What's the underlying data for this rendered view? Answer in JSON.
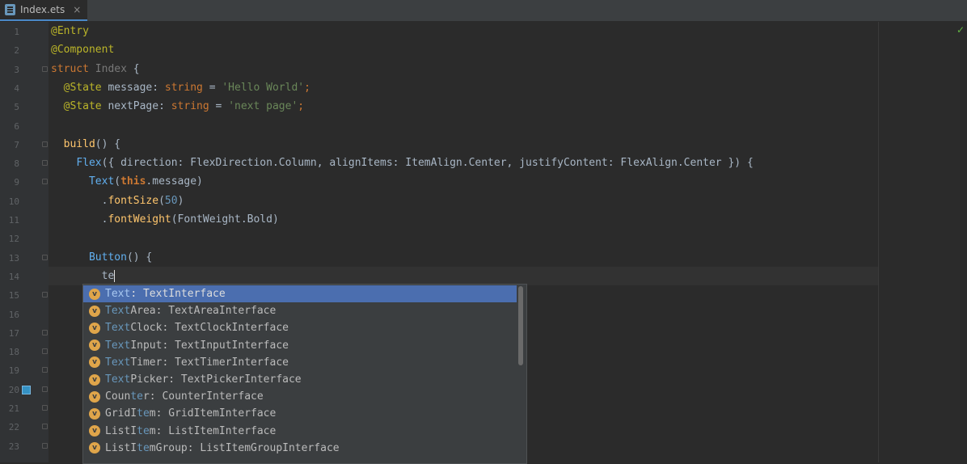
{
  "tab": {
    "label": "Index.ets",
    "close": "×"
  },
  "gutter": {
    "line_numbers": [
      "1",
      "2",
      "3",
      "4",
      "5",
      "6",
      "7",
      "8",
      "9",
      "10",
      "11",
      "12",
      "13",
      "14",
      "15",
      "16",
      "17",
      "18",
      "19",
      "20",
      "21",
      "22",
      "23"
    ]
  },
  "code": {
    "l1": "@Entry",
    "l2": "@Component",
    "l3_kw": "struct",
    "l3_name": "Index",
    "l3_brace": " {",
    "l4_ann": "@State",
    "l4_name": " message",
    "l4_colon": ": ",
    "l4_type": "string",
    "l4_eq": " = ",
    "l4_val": "'Hello World'",
    "l4_end": ";",
    "l5_ann": "@State",
    "l5_name": " nextPage",
    "l5_colon": ": ",
    "l5_type": "string",
    "l5_eq": " = ",
    "l5_val": "'next page'",
    "l5_end": ";",
    "l7_fn": "build",
    "l7_rest": "() {",
    "l8_comp": "Flex",
    "l8_rest": "({ direction: FlexDirection.Column, alignItems: ItemAlign.Center, justifyContent: FlexAlign.Center }) {",
    "l9_comp": "Text",
    "l9_open": "(",
    "l9_this": "this",
    "l9_rest": ".message)",
    "l10_dot": ".",
    "l10_fn": "fontSize",
    "l10_open": "(",
    "l10_num": "50",
    "l10_close": ")",
    "l11_dot": ".",
    "l11_fn": "fontWeight",
    "l11_rest": "(FontWeight.Bold)",
    "l13_comp": "Button",
    "l13_rest": "() {",
    "l14_typed": "te"
  },
  "completion": {
    "items": [
      {
        "match": "Text",
        "rest": ": TextInterface"
      },
      {
        "match": "Text",
        "rest": "Area: TextAreaInterface"
      },
      {
        "match": "Text",
        "rest": "Clock: TextClockInterface"
      },
      {
        "match": "Text",
        "rest": "Input: TextInputInterface"
      },
      {
        "match": "Text",
        "rest": "Timer: TextTimerInterface"
      },
      {
        "match": "Text",
        "rest": "Picker: TextPickerInterface"
      },
      {
        "match": "",
        "pre": "Coun",
        "mid": "te",
        "rest": "r: CounterInterface"
      },
      {
        "match": "",
        "pre": "GridI",
        "mid": "te",
        "rest": "m: GridItemInterface"
      },
      {
        "match": "",
        "pre": "ListI",
        "mid": "te",
        "rest": "m: ListItemInterface"
      },
      {
        "match": "",
        "pre": "ListI",
        "mid": "te",
        "rest": "mGroup: ListItemGroupInterface"
      }
    ],
    "badge": "v"
  }
}
